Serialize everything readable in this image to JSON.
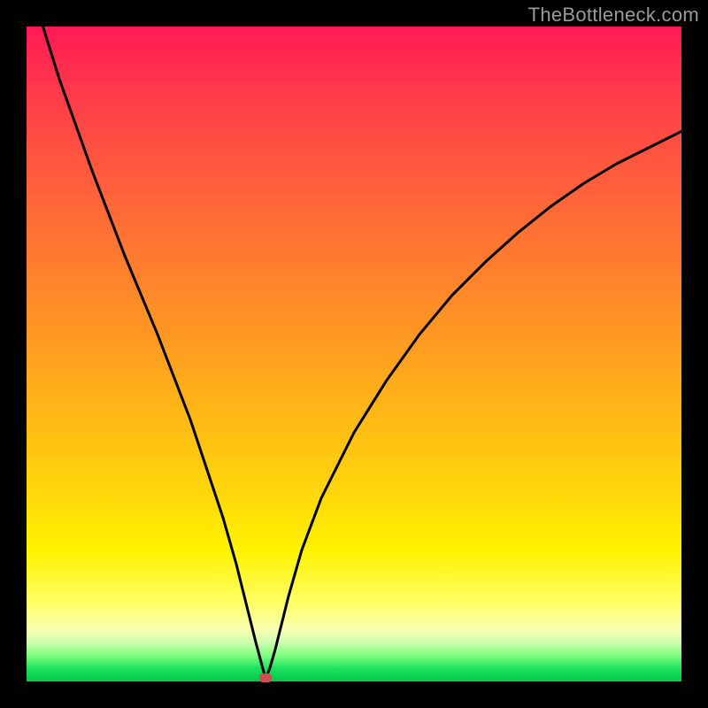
{
  "watermark": "TheBottleneck.com",
  "colors": {
    "frame": "#000000",
    "curve": "#000000",
    "marker": "#cc4e4e",
    "gradient_top": "#ff1a55",
    "gradient_bottom": "#00c84a"
  },
  "chart_data": {
    "type": "line",
    "title": "",
    "xlabel": "",
    "ylabel": "",
    "xlim": [
      0,
      100
    ],
    "ylim": [
      0,
      100
    ],
    "annotations": [
      "TheBottleneck.com"
    ],
    "marker": {
      "x": 36.5,
      "y": 0.5
    },
    "series": [
      {
        "name": "bottleneck-curve",
        "x": [
          0,
          5,
          10,
          15,
          20,
          25,
          28,
          30,
          32,
          33,
          34,
          35,
          35.8,
          36.5,
          37.2,
          38,
          39,
          40,
          42,
          45,
          50,
          55,
          60,
          65,
          70,
          75,
          80,
          85,
          90,
          95,
          100
        ],
        "y": [
          108,
          92,
          78,
          65,
          53,
          40,
          31,
          25,
          18,
          14,
          10,
          6,
          3,
          0.4,
          2.2,
          5,
          9,
          13,
          20,
          28,
          38,
          46,
          53,
          59,
          64,
          68.5,
          72.5,
          76,
          79,
          81.5,
          84
        ]
      }
    ]
  }
}
